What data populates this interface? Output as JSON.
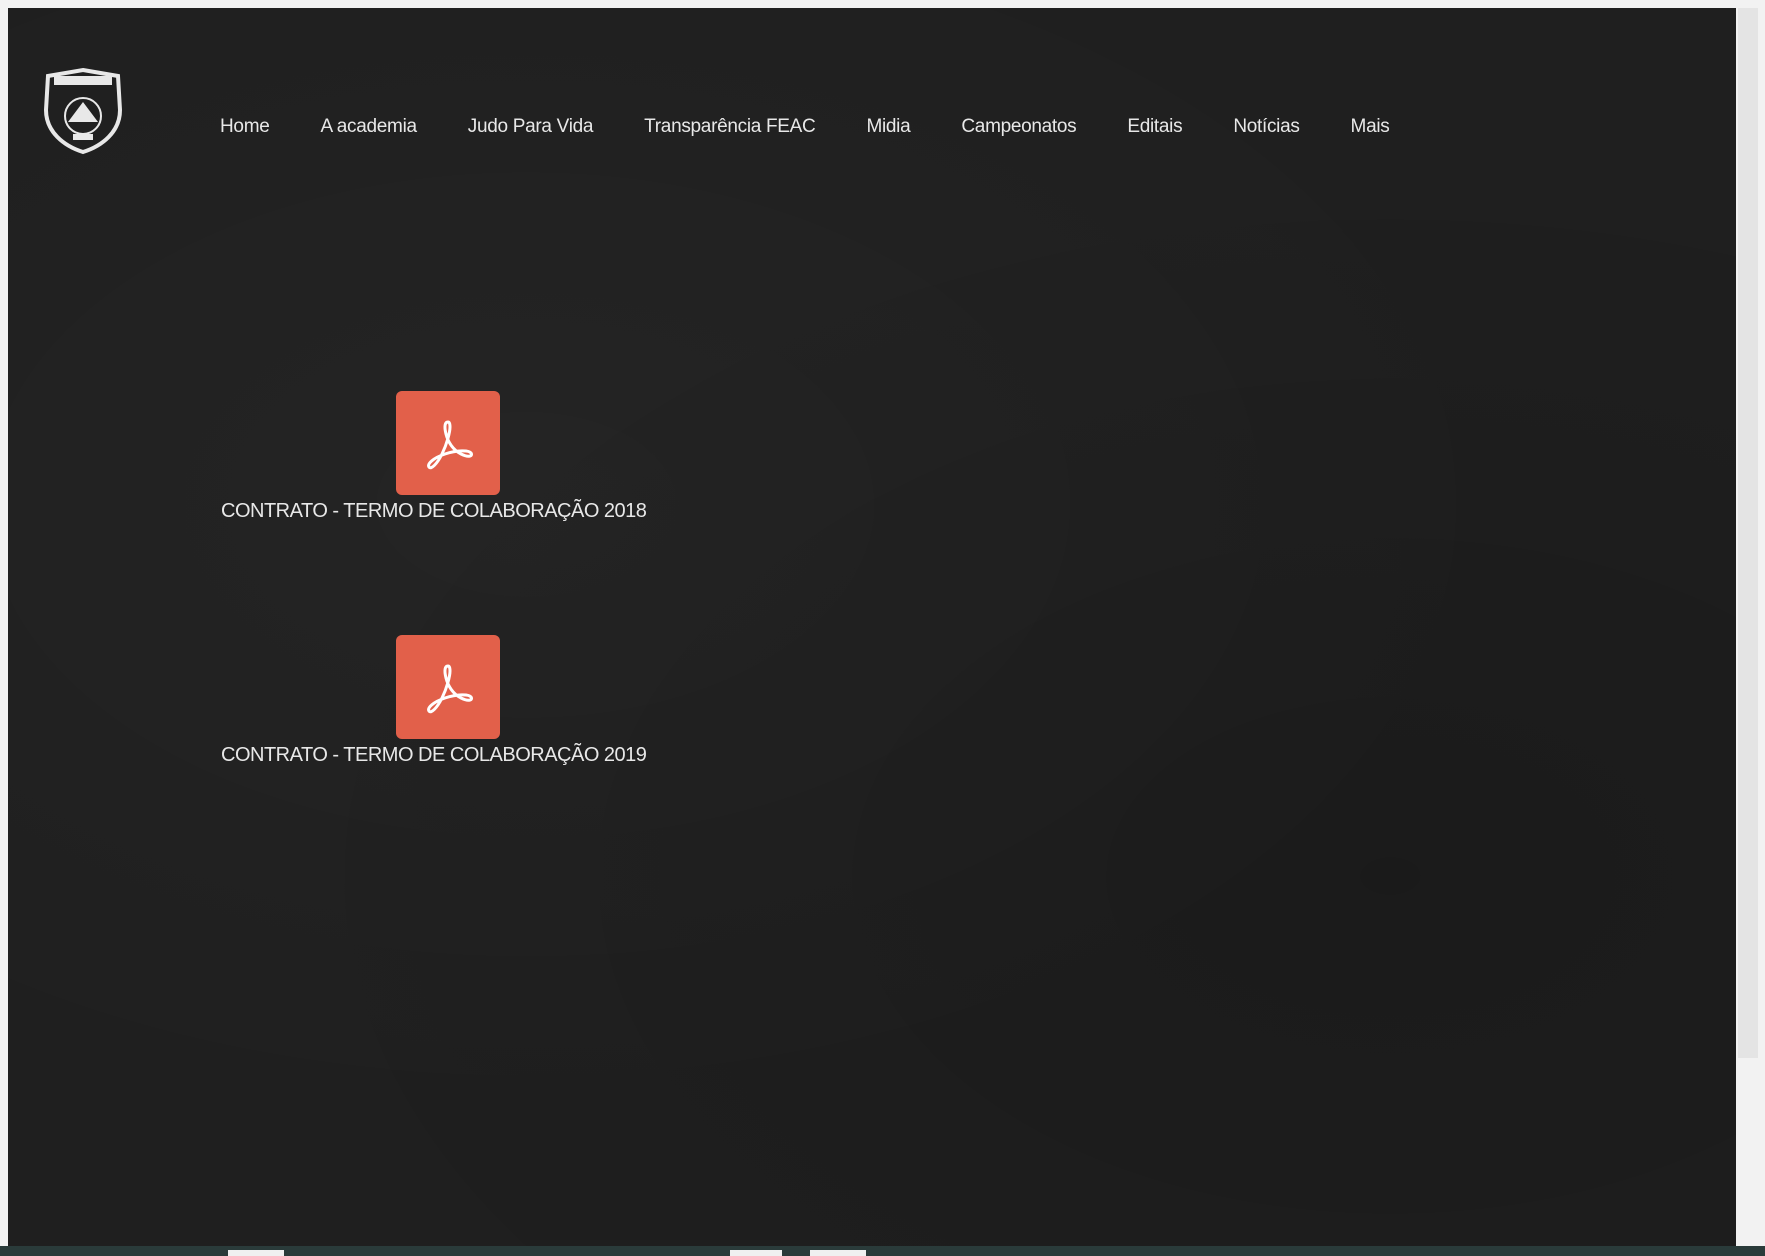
{
  "header": {
    "nav": [
      {
        "label": "Home"
      },
      {
        "label": "A academia"
      },
      {
        "label": "Judo Para Vida"
      },
      {
        "label": "Transparência FEAC"
      },
      {
        "label": "Midia"
      },
      {
        "label": "Campeonatos"
      },
      {
        "label": "Editais"
      },
      {
        "label": "Notícias"
      },
      {
        "label": "Mais"
      }
    ]
  },
  "documents": [
    {
      "label": "CONTRATO - TERMO DE COLABORAÇÃO 2018",
      "icon": "pdf-icon"
    },
    {
      "label": "CONTRATO - TERMO DE COLABORAÇÃO 2019",
      "icon": "pdf-icon"
    }
  ],
  "colors": {
    "background": "#1f1f1f",
    "pdf_icon": "#e2604a",
    "text": "#e8e8e8"
  }
}
